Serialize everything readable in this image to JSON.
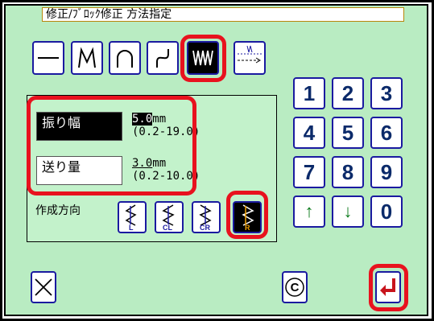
{
  "header": {
    "title": "修正/ﾌﾞﾛｯｸ修正 方法指定"
  },
  "toolbar": {
    "tools": [
      {
        "name": "straight-line-tool",
        "icon": "straight-line-icon",
        "active": false
      },
      {
        "name": "polyline-tool",
        "icon": "polyline-icon",
        "active": false
      },
      {
        "name": "arc-tool",
        "icon": "arc-icon",
        "active": false
      },
      {
        "name": "curve-tool",
        "icon": "curve-icon",
        "active": false
      },
      {
        "name": "zigzag-tool",
        "icon": "zigzag-icon",
        "active": true
      },
      {
        "name": "stitch-feed-tool",
        "icon": "stitch-feed-icon",
        "active": false
      }
    ]
  },
  "settings": {
    "width": {
      "label": "振り幅",
      "value": "5.0",
      "unit": "mm",
      "range": "(0.2-19.0)",
      "selected": true
    },
    "feed": {
      "label": "送り量",
      "value": "3.0",
      "unit": "mm",
      "range": "(0.2-10.0)",
      "selected": false
    }
  },
  "direction": {
    "label": "作成方向",
    "options": [
      {
        "code": "L",
        "active": false
      },
      {
        "code": "CL",
        "active": false
      },
      {
        "code": "CR",
        "active": false
      },
      {
        "code": "R",
        "active": true
      }
    ]
  },
  "keypad": {
    "keys": [
      "1",
      "2",
      "3",
      "4",
      "5",
      "6",
      "7",
      "8",
      "9",
      "↑",
      "↓",
      "0"
    ]
  },
  "footer": {
    "cancel_icon": "close-icon",
    "clear_label": "C",
    "enter_icon": "enter-icon"
  },
  "colors": {
    "highlight": "#e8121e",
    "panel": "#b9ecc2",
    "button_border": "#1a1aa0",
    "direction_accent": "#f0a000"
  }
}
